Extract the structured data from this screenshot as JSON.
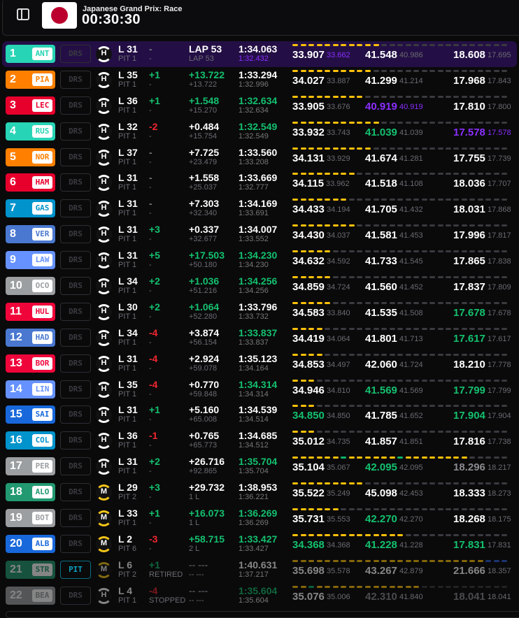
{
  "header": {
    "event": "Japanese Grand Prix: Race",
    "clock": "00:30:30",
    "flag": "japan-flag"
  },
  "rows": [
    {
      "pos": "1",
      "code": "ANT",
      "team": "#27d4b5",
      "box": "DRS",
      "tyre": "H",
      "lap": "L 31",
      "pit": "PIT 1",
      "delta": "-",
      "dc": "none",
      "status": "-",
      "gap": "LAP 53",
      "gc": "normal",
      "int": "LAP 53",
      "lt": "1:34.063",
      "ltc": "normal",
      "best": "1:32.432",
      "bc": "overall",
      "s": [
        [
          "33.907",
          "normal",
          "33.662",
          "overall"
        ],
        [
          "41.548",
          "normal",
          "40.986",
          "stale"
        ],
        [
          "18.608",
          "normal",
          "17.695",
          "stale"
        ]
      ],
      "mini": [
        "yyyyyyyyy",
        "yynnnnnnnnn",
        "nnnnnnn"
      ]
    },
    {
      "pos": "2",
      "code": "PIA",
      "team": "#ff8000",
      "box": "DRS",
      "tyre": "H",
      "lap": "L 35",
      "pit": "PIT 1",
      "delta": "+1",
      "dc": "gain",
      "status": "-",
      "gap": "+13.722",
      "gc": "personal",
      "int": "+13.722",
      "lt": "1:33.294",
      "ltc": "normal",
      "best": "1:32.996",
      "bc": "stale",
      "s": [
        [
          "34.027",
          "normal",
          "33.887",
          "stale"
        ],
        [
          "41.299",
          "normal",
          "41.214",
          "stale"
        ],
        [
          "17.968",
          "normal",
          "17.843",
          "stale"
        ]
      ],
      "mini": [
        "yyyyyyyyy",
        "ynnnnnnnnnn",
        "nnnnnnn"
      ]
    },
    {
      "pos": "3",
      "code": "LEC",
      "team": "#e8002d",
      "box": "DRS",
      "tyre": "H",
      "lap": "L 36",
      "pit": "PIT 1",
      "delta": "+1",
      "dc": "gain",
      "status": "-",
      "gap": "+1.548",
      "gc": "personal",
      "int": "+15.270",
      "lt": "1:32.634",
      "ltc": "personal",
      "best": "1:32.634",
      "bc": "stale",
      "s": [
        [
          "33.905",
          "normal",
          "33.676",
          "stale"
        ],
        [
          "40.919",
          "overall",
          "40.919",
          "overall"
        ],
        [
          "17.810",
          "normal",
          "17.800",
          "stale"
        ]
      ],
      "mini": [
        "yyyyyyyyy",
        "nnnnnnnnnnn",
        "nnnnnnn"
      ]
    },
    {
      "pos": "4",
      "code": "RUS",
      "team": "#27d4b5",
      "box": "DRS",
      "tyre": "H",
      "lap": "L 32",
      "pit": "PIT 1",
      "delta": "-2",
      "dc": "loss",
      "status": "-",
      "gap": "+0.484",
      "gc": "normal",
      "int": "+15.754",
      "lt": "1:32.549",
      "ltc": "personal",
      "best": "1:32.549",
      "bc": "stale",
      "s": [
        [
          "33.932",
          "normal",
          "33.743",
          "stale"
        ],
        [
          "41.039",
          "personal",
          "41.039",
          "stale"
        ],
        [
          "17.578",
          "overall",
          "17.578",
          "overall"
        ]
      ],
      "mini": [
        "yyyyyyyyy",
        "yynnnnnnnnn",
        "nnnnnnn"
      ]
    },
    {
      "pos": "5",
      "code": "NOR",
      "team": "#ff8000",
      "box": "DRS",
      "tyre": "H",
      "lap": "L 37",
      "pit": "PIT 1",
      "delta": "-",
      "dc": "none",
      "status": "-",
      "gap": "+7.725",
      "gc": "normal",
      "int": "+23.479",
      "lt": "1:33.560",
      "ltc": "normal",
      "best": "1:33.208",
      "bc": "stale",
      "s": [
        [
          "34.131",
          "normal",
          "33.929",
          "stale"
        ],
        [
          "41.674",
          "normal",
          "41.281",
          "stale"
        ],
        [
          "17.755",
          "normal",
          "17.739",
          "stale"
        ]
      ],
      "mini": [
        "yyyyyyyyy",
        "ynnnnnnnnnn",
        "nnnnnnn"
      ]
    },
    {
      "pos": "6",
      "code": "HAM",
      "team": "#e8002d",
      "box": "DRS",
      "tyre": "H",
      "lap": "L 31",
      "pit": "PIT 1",
      "delta": "-",
      "dc": "none",
      "status": "-",
      "gap": "+1.558",
      "gc": "normal",
      "int": "+25.037",
      "lt": "1:33.669",
      "ltc": "normal",
      "best": "1:32.777",
      "bc": "stale",
      "s": [
        [
          "34.115",
          "normal",
          "33.962",
          "stale"
        ],
        [
          "41.518",
          "normal",
          "41.108",
          "stale"
        ],
        [
          "18.036",
          "normal",
          "17.707",
          "stale"
        ]
      ],
      "mini": [
        "yyyyyyyyn",
        "nnnnnnnnnnn",
        "nnnnnnn"
      ]
    },
    {
      "pos": "7",
      "code": "GAS",
      "team": "#0093cc",
      "box": "DRS",
      "tyre": "H",
      "lap": "L 31",
      "pit": "PIT 1",
      "delta": "-",
      "dc": "none",
      "status": "-",
      "gap": "+7.303",
      "gc": "normal",
      "int": "+32.340",
      "lt": "1:34.169",
      "ltc": "normal",
      "best": "1:33.691",
      "bc": "stale",
      "s": [
        [
          "34.433",
          "normal",
          "34.194",
          "stale"
        ],
        [
          "41.705",
          "normal",
          "41.432",
          "stale"
        ],
        [
          "18.031",
          "normal",
          "17.868",
          "stale"
        ]
      ],
      "mini": [
        "yyyyyyynn",
        "nnnnnnnnnnn",
        "nnnnnnn"
      ]
    },
    {
      "pos": "8",
      "code": "VER",
      "team": "#4a78d0",
      "box": "DRS",
      "tyre": "H",
      "lap": "L 31",
      "pit": "PIT 1",
      "delta": "+3",
      "dc": "gain",
      "status": "-",
      "gap": "+0.337",
      "gc": "normal",
      "int": "+32.677",
      "lt": "1:34.007",
      "ltc": "normal",
      "best": "1:33.552",
      "bc": "stale",
      "s": [
        [
          "34.430",
          "normal",
          "34.037",
          "stale"
        ],
        [
          "41.581",
          "normal",
          "41.453",
          "stale"
        ],
        [
          "17.996",
          "normal",
          "17.817",
          "stale"
        ]
      ],
      "mini": [
        "yyyyyyyyn",
        "nnnnnnnnnnn",
        "nnnnnnn"
      ]
    },
    {
      "pos": "9",
      "code": "LAW",
      "team": "#6692ff",
      "box": "DRS",
      "tyre": "H",
      "lap": "L 31",
      "pit": "PIT 1",
      "delta": "+5",
      "dc": "gain",
      "status": "-",
      "gap": "+17.503",
      "gc": "personal",
      "int": "+50.180",
      "lt": "1:34.230",
      "ltc": "personal",
      "best": "1:34.230",
      "bc": "stale",
      "s": [
        [
          "34.632",
          "normal",
          "34.592",
          "stale"
        ],
        [
          "41.733",
          "normal",
          "41.545",
          "stale"
        ],
        [
          "17.865",
          "normal",
          "17.838",
          "stale"
        ]
      ],
      "mini": [
        "yyyyynnnn",
        "nnnnnnnnnnn",
        "nnnnnnn"
      ]
    },
    {
      "pos": "10",
      "code": "OCO",
      "team": "#9c9fa2",
      "box": "DRS",
      "tyre": "H",
      "lap": "L 34",
      "pit": "PIT 1",
      "delta": "+2",
      "dc": "gain",
      "status": "-",
      "gap": "+1.036",
      "gc": "personal",
      "int": "+51.216",
      "lt": "1:34.256",
      "ltc": "personal",
      "best": "1:34.256",
      "bc": "stale",
      "s": [
        [
          "34.859",
          "normal",
          "34.724",
          "stale"
        ],
        [
          "41.560",
          "normal",
          "41.452",
          "stale"
        ],
        [
          "17.837",
          "normal",
          "17.809",
          "stale"
        ]
      ],
      "mini": [
        "yyyyynnnn",
        "nnnnnnnnnnn",
        "nnnnnnn"
      ]
    },
    {
      "pos": "11",
      "code": "HUL",
      "team": "#f0053a",
      "box": "DRS",
      "tyre": "H",
      "lap": "L 30",
      "pit": "PIT 1",
      "delta": "+2",
      "dc": "gain",
      "status": "-",
      "gap": "+1.064",
      "gc": "personal",
      "int": "+52.280",
      "lt": "1:33.796",
      "ltc": "normal",
      "best": "1:33.732",
      "bc": "stale",
      "s": [
        [
          "34.583",
          "normal",
          "33.840",
          "stale"
        ],
        [
          "41.535",
          "normal",
          "41.508",
          "stale"
        ],
        [
          "17.678",
          "personal",
          "17.678",
          "stale"
        ]
      ],
      "mini": [
        "yyyyynnnn",
        "nnnnnnnnnnn",
        "nnnnnnn"
      ]
    },
    {
      "pos": "12",
      "code": "HAD",
      "team": "#4a78d0",
      "box": "DRS",
      "tyre": "H",
      "lap": "L 34",
      "pit": "PIT 1",
      "delta": "-4",
      "dc": "loss",
      "status": "-",
      "gap": "+3.874",
      "gc": "normal",
      "int": "+56.154",
      "lt": "1:33.837",
      "ltc": "personal",
      "best": "1:33.837",
      "bc": "stale",
      "s": [
        [
          "34.419",
          "normal",
          "34.064",
          "stale"
        ],
        [
          "41.801",
          "normal",
          "41.713",
          "stale"
        ],
        [
          "17.617",
          "personal",
          "17.617",
          "stale"
        ]
      ],
      "mini": [
        "yyyynnnnn",
        "nnnnnnnnnnn",
        "nnnnnnn"
      ]
    },
    {
      "pos": "13",
      "code": "BOR",
      "team": "#f0053a",
      "box": "DRS",
      "tyre": "H",
      "lap": "L 31",
      "pit": "PIT 1",
      "delta": "-4",
      "dc": "loss",
      "status": "-",
      "gap": "+2.924",
      "gc": "normal",
      "int": "+59.078",
      "lt": "1:35.123",
      "ltc": "normal",
      "best": "1:34.164",
      "bc": "stale",
      "s": [
        [
          "34.853",
          "normal",
          "34.497",
          "stale"
        ],
        [
          "42.060",
          "normal",
          "41.724",
          "stale"
        ],
        [
          "18.210",
          "normal",
          "17.778",
          "stale"
        ]
      ],
      "mini": [
        "yyyynnnnn",
        "nnnnnnnnnnn",
        "nnnnnnn"
      ]
    },
    {
      "pos": "14",
      "code": "LIN",
      "team": "#6692ff",
      "box": "DRS",
      "tyre": "H",
      "lap": "L 35",
      "pit": "PIT 1",
      "delta": "-4",
      "dc": "loss",
      "status": "-",
      "gap": "+0.770",
      "gc": "normal",
      "int": "+59.848",
      "lt": "1:34.314",
      "ltc": "personal",
      "best": "1:34.314",
      "bc": "stale",
      "s": [
        [
          "34.946",
          "normal",
          "34.810",
          "stale"
        ],
        [
          "41.569",
          "personal",
          "41.569",
          "stale"
        ],
        [
          "17.799",
          "personal",
          "17.799",
          "stale"
        ]
      ],
      "mini": [
        "yyynnnnnn",
        "nnnnnnnnnnn",
        "nnnnnnn"
      ]
    },
    {
      "pos": "15",
      "code": "SAI",
      "team": "#1868db",
      "box": "DRS",
      "tyre": "H",
      "lap": "L 31",
      "pit": "PIT 1",
      "delta": "+1",
      "dc": "gain",
      "status": "-",
      "gap": "+5.160",
      "gc": "normal",
      "int": "+65.008",
      "lt": "1:34.539",
      "ltc": "normal",
      "best": "1:34.514",
      "bc": "stale",
      "s": [
        [
          "34.850",
          "personal",
          "34.850",
          "stale"
        ],
        [
          "41.785",
          "normal",
          "41.652",
          "stale"
        ],
        [
          "17.904",
          "personal",
          "17.904",
          "stale"
        ]
      ],
      "mini": [
        "yyynnnnnn",
        "nnnnnnnnnnn",
        "nnnnnnn"
      ]
    },
    {
      "pos": "16",
      "code": "COL",
      "team": "#0093cc",
      "box": "DRS",
      "tyre": "H",
      "lap": "L 36",
      "pit": "PIT 1",
      "delta": "-1",
      "dc": "loss",
      "status": "-",
      "gap": "+0.765",
      "gc": "normal",
      "int": "+65.773",
      "lt": "1:34.685",
      "ltc": "normal",
      "best": "1:34.512",
      "bc": "stale",
      "s": [
        [
          "35.012",
          "normal",
          "34.735",
          "stale"
        ],
        [
          "41.857",
          "normal",
          "41.851",
          "stale"
        ],
        [
          "17.816",
          "normal",
          "17.738",
          "stale"
        ]
      ],
      "mini": [
        "yyynnnnnn",
        "nnnnnnnnnnn",
        "nnnnnnn"
      ]
    },
    {
      "pos": "17",
      "code": "PER",
      "team": "#9c9fa2",
      "box": "DRS",
      "tyre": "H",
      "lap": "L 31",
      "pit": "PIT 1",
      "delta": "+2",
      "dc": "gain",
      "status": "-",
      "gap": "+26.716",
      "gc": "normal",
      "int": "+92.865",
      "lt": "1:35.704",
      "ltc": "personal",
      "best": "1:35.704",
      "bc": "stale",
      "s": [
        [
          "35.104",
          "normal",
          "35.067",
          "stale"
        ],
        [
          "42.095",
          "personal",
          "42.095",
          "stale"
        ],
        [
          "18.296",
          "stale",
          "18.217",
          "stale"
        ]
      ],
      "mini": [
        "yyyyyygyy",
        "yyyygyyyyyy",
        "yynnnnn"
      ]
    },
    {
      "pos": "18",
      "code": "ALO",
      "team": "#229971",
      "box": "DRS",
      "tyre": "M",
      "lap": "L 29",
      "pit": "PIT 2",
      "delta": "+3",
      "dc": "gain",
      "status": "-",
      "gap": "+29.732",
      "gc": "normal",
      "int": "1 L",
      "lt": "1:38.953",
      "ltc": "normal",
      "best": "1:36.221",
      "bc": "stale",
      "s": [
        [
          "35.522",
          "normal",
          "35.249",
          "stale"
        ],
        [
          "45.098",
          "normal",
          "42.453",
          "stale"
        ],
        [
          "18.333",
          "normal",
          "18.273",
          "stale"
        ]
      ],
      "mini": [
        "yyyyyyyyy",
        "nnnnnnnnnnn",
        "nnnnnnn"
      ]
    },
    {
      "pos": "19",
      "code": "BOT",
      "team": "#9c9fa2",
      "box": "DRS",
      "tyre": "M",
      "lap": "L 33",
      "pit": "PIT 1",
      "delta": "+1",
      "dc": "gain",
      "status": "-",
      "gap": "+16.073",
      "gc": "personal",
      "int": "1 L",
      "lt": "1:36.269",
      "ltc": "personal",
      "best": "1:36.269",
      "bc": "stale",
      "s": [
        [
          "35.731",
          "normal",
          "35.553",
          "stale"
        ],
        [
          "42.270",
          "personal",
          "42.270",
          "stale"
        ],
        [
          "18.268",
          "normal",
          "18.175",
          "stale"
        ]
      ],
      "mini": [
        "yyyyyynnn",
        "nnnnnnnnnnn",
        "nnnnnnn"
      ]
    },
    {
      "pos": "20",
      "code": "ALB",
      "team": "#1868db",
      "box": "DRS",
      "tyre": "M",
      "lap": "L 2",
      "pit": "PIT 6",
      "delta": "-3",
      "dc": "loss",
      "status": "-",
      "gap": "+58.715",
      "gc": "personal",
      "int": "2 L",
      "lt": "1:33.427",
      "ltc": "personal",
      "best": "1:33.427",
      "bc": "stale",
      "s": [
        [
          "34.368",
          "personal",
          "34.368",
          "stale"
        ],
        [
          "41.228",
          "personal",
          "41.228",
          "stale"
        ],
        [
          "17.831",
          "personal",
          "17.831",
          "stale"
        ]
      ],
      "mini": [
        "yyyyyyyyy",
        "yyyyynnnnnn",
        "nnnnnnn"
      ]
    },
    {
      "pos": "21",
      "code": "STR",
      "team": "#229971",
      "box": "PIT",
      "tyre": "M",
      "lap": "L 6",
      "pit": "PIT 2",
      "delta": "+1",
      "dc": "gain",
      "status": "RETIRED",
      "gap": "-- ---",
      "gc": "stale",
      "int": "-- ---",
      "lt": "1:40.631",
      "ltc": "normal",
      "best": "1:37.217",
      "bc": "stale",
      "dim": true,
      "s": [
        [
          "35.698",
          "normal",
          "35.578",
          "stale"
        ],
        [
          "43.267",
          "normal",
          "42.879",
          "stale"
        ],
        [
          "21.666",
          "normal",
          "18.357",
          "stale"
        ]
      ],
      "mini": [
        "yyyyyyyyy",
        "yyyyyyyyyyy",
        "yyyybbb"
      ]
    },
    {
      "pos": "22",
      "code": "BEA",
      "team": "#9c9fa2",
      "box": "DRS",
      "tyre": "H",
      "lap": "L 4",
      "pit": "PIT 1",
      "delta": "-4",
      "dc": "loss",
      "status": "STOPPED",
      "gap": "-- ---",
      "gc": "stale",
      "int": "-- ---",
      "lt": "1:35.604",
      "ltc": "personal",
      "best": "1:35.604",
      "bc": "stale",
      "dim": true,
      "s": [
        [
          "35.076",
          "normal",
          "35.006",
          "stale"
        ],
        [
          "42.310",
          "stale",
          "41.840",
          "stale"
        ],
        [
          "18.041",
          "stale",
          "18.041",
          "stale"
        ]
      ],
      "mini": [
        "yygyyyyyy",
        "yyyyyyynnnn",
        "nnnnnnn"
      ]
    }
  ]
}
